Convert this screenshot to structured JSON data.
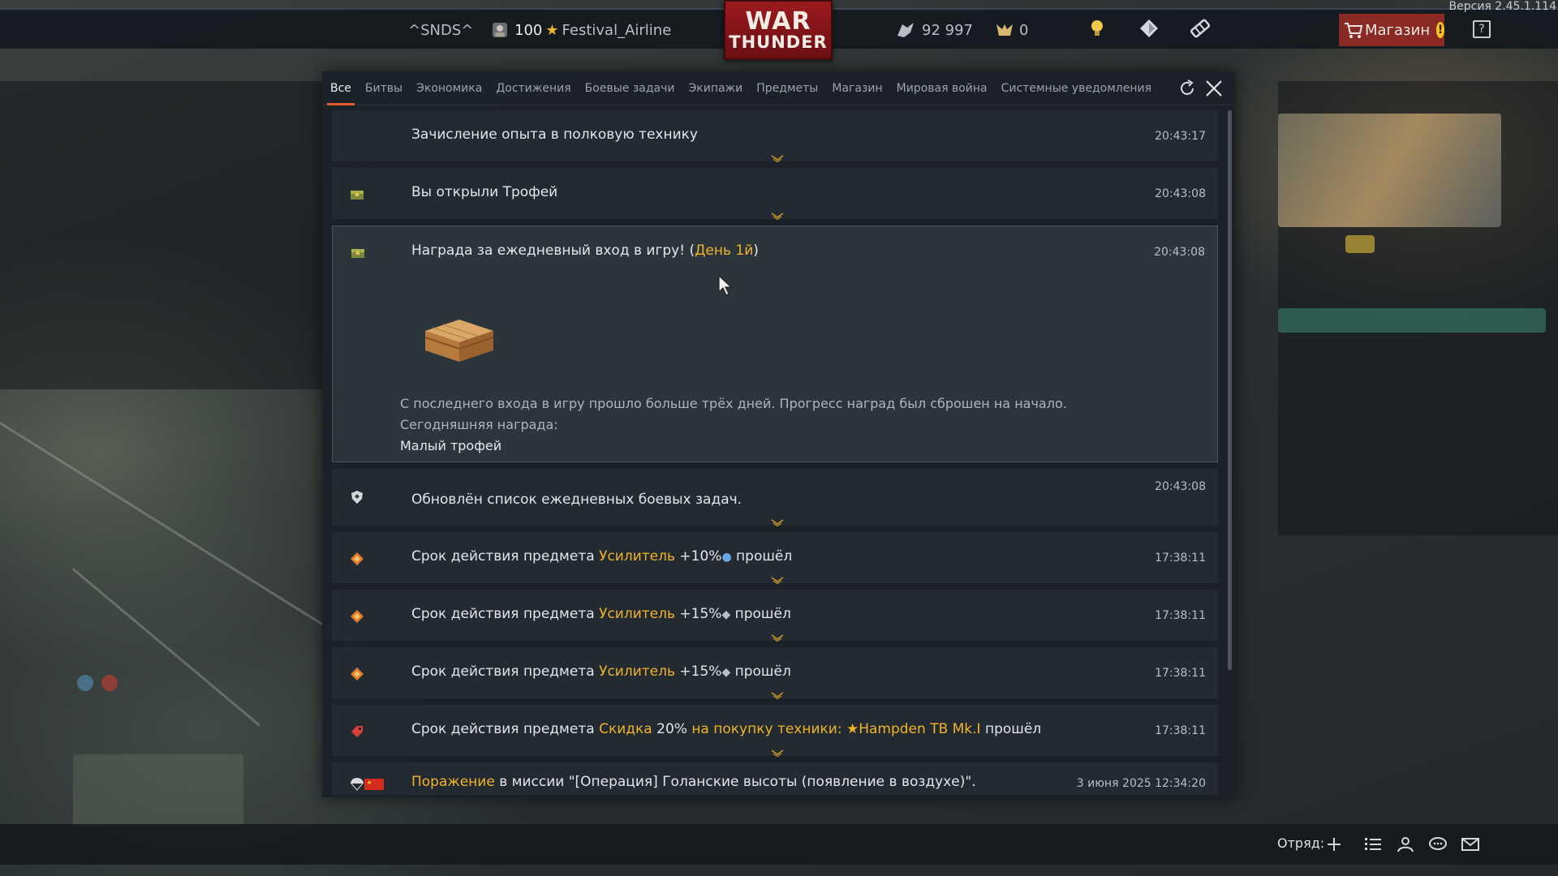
{
  "version": "Версия 2.45.1.114",
  "topbar": {
    "squadron_tag": "^SNDS^",
    "rank": "100",
    "nickname": "Festival_Airline",
    "logo_line1": "WAR",
    "logo_line2": "THUNDER",
    "silver_lions": "92 997",
    "golden_eagles": "0",
    "shop_label": "Магазин",
    "help_label": "?"
  },
  "tabs": [
    {
      "label": "Все",
      "active": true
    },
    {
      "label": "Битвы"
    },
    {
      "label": "Экономика"
    },
    {
      "label": "Достижения"
    },
    {
      "label": "Боевые задачи"
    },
    {
      "label": "Экипажи"
    },
    {
      "label": "Предметы"
    },
    {
      "label": "Магазин"
    },
    {
      "label": "Мировая война"
    },
    {
      "label": "Системные уведомления"
    }
  ],
  "notifications": [
    {
      "icon": "none",
      "text": "Зачисление опыта в полковую технику",
      "time": "20:43:17"
    },
    {
      "icon": "trophy-chest-icon",
      "text": "Вы открыли Трофей",
      "time": "20:43:08"
    },
    {
      "icon": "trophy-chest-icon",
      "text_prefix": "Награда за ежедневный вход в игру! (",
      "text_highlight": "День 1й",
      "text_suffix": ")",
      "time": "20:43:08",
      "body_line1": "С последнего входа в игру прошло больше трёх дней. Прогресс наград был сброшен на начало.",
      "body_line2": "Сегодняшняя награда:",
      "body_line3": "Малый трофей"
    },
    {
      "icon": "shield-icon",
      "text": "Обновлён список ежедневных боевых задач.",
      "time": "20:43:08"
    },
    {
      "icon": "booster-icon",
      "prefix": "Срок действия предмета ",
      "item": "Усилитель",
      "value": " +10%",
      "suffix": " прошёл",
      "time": "17:38:11",
      "currency": "research"
    },
    {
      "icon": "booster-icon",
      "prefix": "Срок действия предмета ",
      "item": "Усилитель",
      "value": " +15%",
      "suffix": " прошёл",
      "time": "17:38:11",
      "currency": "silver"
    },
    {
      "icon": "booster-icon",
      "prefix": "Срок действия предмета ",
      "item": "Усилитель",
      "value": " +15%",
      "suffix": " прошёл",
      "time": "17:38:11",
      "currency": "silver"
    },
    {
      "icon": "discount-tag-icon",
      "prefix": "Срок действия предмета ",
      "item": "Скидка",
      "value": " 20% ",
      "extra": "на покупку техники: ★Hampden TB Mk.I",
      "suffix": " прошёл",
      "time": "17:38:11"
    },
    {
      "icon": "parachute-icon",
      "highlight": "Поражение",
      "text": " в миссии \"[Операция] Голанские высоты (появление в воздухе)\".",
      "time": "3 июня 2025 12:34:20"
    }
  ],
  "bottombar": {
    "squad_label": "Отряд:"
  },
  "colors": {
    "highlight": "#f0b429",
    "tab_active_underline": "#e05a2a",
    "modal_bg": "#1c2128"
  }
}
